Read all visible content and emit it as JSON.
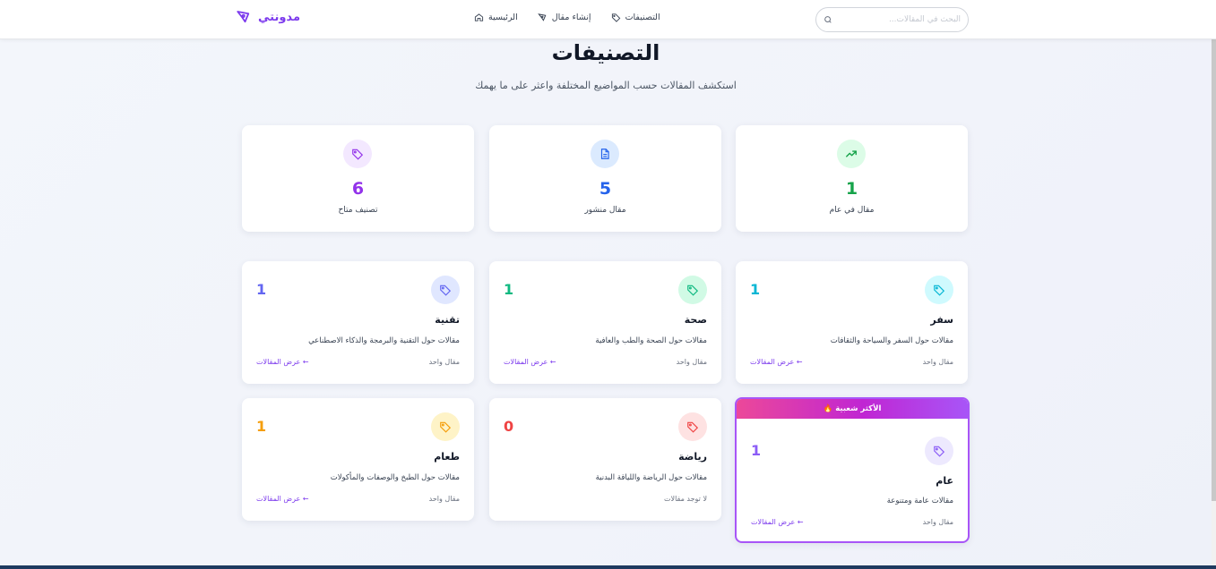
{
  "header": {
    "brand": "مدونتي",
    "nav": [
      {
        "label": "التصنيفات",
        "icon": "tag-icon"
      },
      {
        "label": "إنشاء مقال",
        "icon": "pen-icon"
      },
      {
        "label": "الرئيسية",
        "icon": "home-icon"
      }
    ],
    "search_placeholder": "البحث في المقالات..."
  },
  "page": {
    "title": "التصنيفات",
    "subtitle": "استكشف المقالات حسب المواضيع المختلفة واعثر على ما يهمك"
  },
  "stats": [
    {
      "value": "1",
      "label": "مقال في عام",
      "color": "#16a34a",
      "bg": "#dcfce7",
      "icon": "trending-up-icon"
    },
    {
      "value": "5",
      "label": "مقال منشور",
      "color": "#2563eb",
      "bg": "#dbeafe",
      "icon": "document-icon"
    },
    {
      "value": "6",
      "label": "تصنيف متاح",
      "color": "#9333ea",
      "bg": "#f3e8ff",
      "icon": "tag-icon"
    }
  ],
  "categories": [
    {
      "name": "سفر",
      "count": "1",
      "description": "مقالات حول السفر والسياحة والثقافات",
      "meta": "مقال واحد",
      "link": "← عرض المقالات",
      "color": "#06b6d4",
      "bg": "#cffafe"
    },
    {
      "name": "صحة",
      "count": "1",
      "description": "مقالات حول الصحة والطب والعافية",
      "meta": "مقال واحد",
      "link": "← عرض المقالات",
      "color": "#10b981",
      "bg": "#d1fae5"
    },
    {
      "name": "تقنية",
      "count": "1",
      "description": "مقالات حول التقنية والبرمجة والذكاء الاصطناعي",
      "meta": "مقال واحد",
      "link": "← عرض المقالات",
      "color": "#6366f1",
      "bg": "#e0e7ff"
    },
    {
      "name": "عام",
      "count": "1",
      "description": "مقالات عامة ومتنوعة",
      "meta": "مقال واحد",
      "link": "← عرض المقالات",
      "color": "#8b5cf6",
      "bg": "#ede9fe",
      "featured_label": "الأكثر شعبية 🔥"
    },
    {
      "name": "رياضة",
      "count": "0",
      "description": "مقالات حول الرياضة واللياقة البدنية",
      "meta": "لا توجد مقالات",
      "link": "",
      "color": "#ef4444",
      "bg": "#fee2e2"
    },
    {
      "name": "طعام",
      "count": "1",
      "description": "مقالات حول الطبخ والوصفات والمأكولات",
      "meta": "مقال واحد",
      "link": "← عرض المقالات",
      "color": "#f59e0b",
      "bg": "#fef3c7"
    }
  ]
}
